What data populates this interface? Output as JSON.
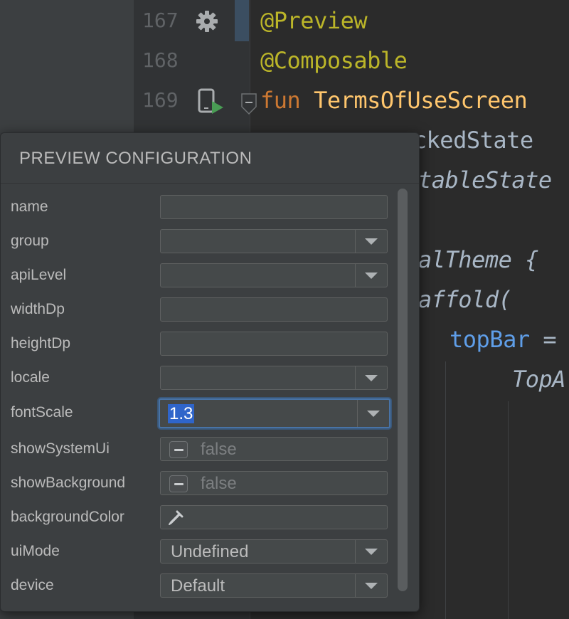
{
  "editor": {
    "line_numbers": [
      "167",
      "168",
      "169"
    ],
    "line_167": "@Preview",
    "line_168": "@Composable",
    "line_169_keyword": "fun",
    "line_169_name": "TermsOfUseScreen",
    "partial_lines": {
      "checked": "eckedState",
      "table": "tableState",
      "theme": "alTheme {",
      "scaffold": "affold(",
      "topbar_param": "topBar",
      "topbar_eq": "=",
      "topapp": "TopA"
    },
    "icons": [
      "gear-icon",
      "device-preview-icon",
      "run-icon",
      "fold-icon"
    ]
  },
  "popup": {
    "title": "PREVIEW CONFIGURATION",
    "fields": {
      "name": {
        "label": "name",
        "value": ""
      },
      "group": {
        "label": "group",
        "value": ""
      },
      "apiLevel": {
        "label": "apiLevel",
        "value": ""
      },
      "widthDp": {
        "label": "widthDp",
        "value": ""
      },
      "heightDp": {
        "label": "heightDp",
        "value": ""
      },
      "locale": {
        "label": "locale",
        "value": ""
      },
      "fontScale": {
        "label": "fontScale",
        "value": "1.3"
      },
      "showSystemUi": {
        "label": "showSystemUi",
        "value": "false"
      },
      "showBackground": {
        "label": "showBackground",
        "value": "false"
      },
      "backgroundColor": {
        "label": "backgroundColor",
        "value": ""
      },
      "uiMode": {
        "label": "uiMode",
        "value": "Undefined"
      },
      "device": {
        "label": "device",
        "value": "Default"
      }
    }
  },
  "colors": {
    "background": "#2b2b2b",
    "annotation": "#bbb529",
    "keyword": "#cc7832",
    "function": "#ffc66d",
    "param": "#5f9ee8",
    "focus": "#4873a6",
    "selection": "#2f65ca"
  }
}
